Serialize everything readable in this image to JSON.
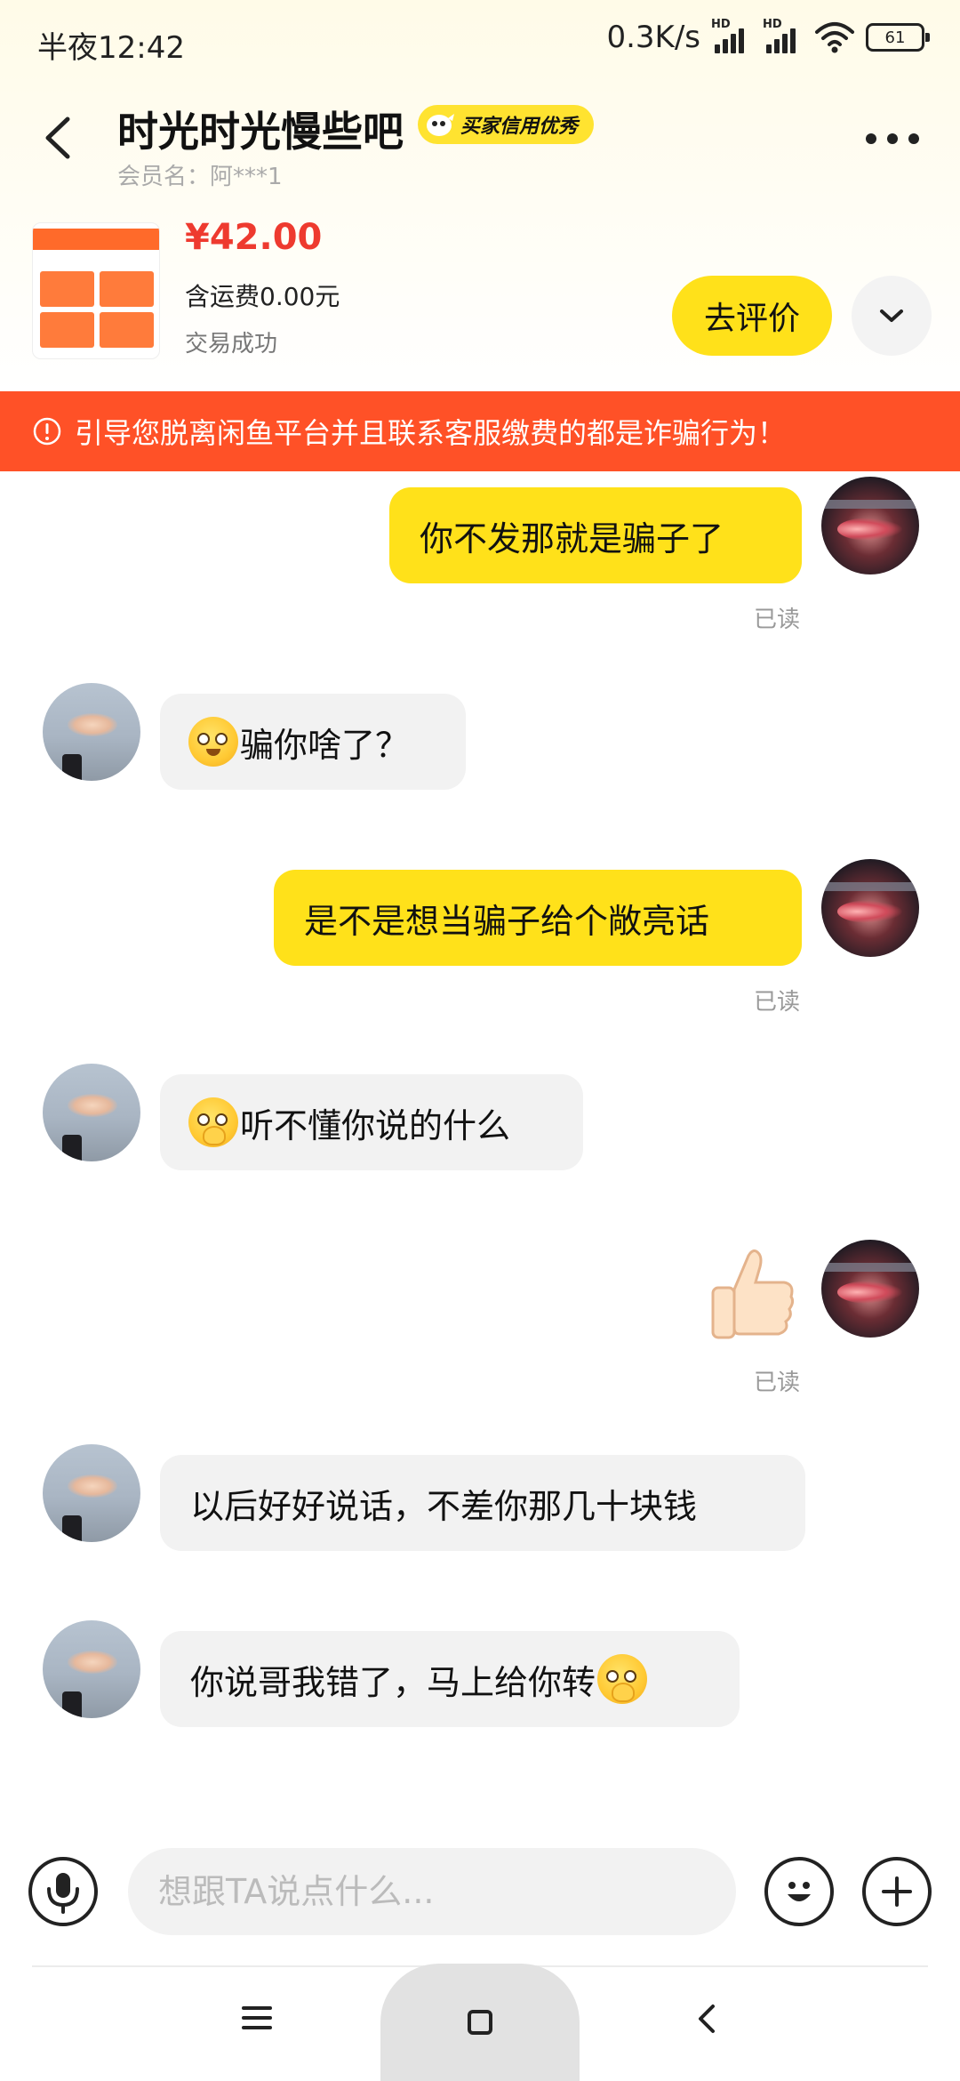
{
  "status_bar": {
    "time": "半夜12:42",
    "net_speed": "0.3K/s",
    "signal_tag": "HD",
    "battery": "61"
  },
  "header": {
    "title": "时光时光慢些吧",
    "credit_badge": "买家信用优秀",
    "member_label": "会员名：阿***1"
  },
  "product": {
    "price": "¥42.00",
    "shipping": "含运费0.00元",
    "status": "交易成功",
    "review_button": "去评价"
  },
  "warning": "引导您脱离闲鱼平台并且联系客服缴费的都是诈骗行为！",
  "messages": [
    {
      "side": "me",
      "text": "你不发那就是骗子了",
      "read": "已读"
    },
    {
      "side": "other",
      "text": "骗你啥了？",
      "emoji": "pleading-face"
    },
    {
      "side": "me",
      "text": "是不是想当骗子给个敞亮话",
      "read": "已读"
    },
    {
      "side": "other",
      "text": "听不懂你说的什么",
      "emoji": "face-holding-back-tears"
    },
    {
      "side": "me",
      "emoji": "thumbs-up",
      "read": "已读"
    },
    {
      "side": "other",
      "text": "以后好好说话，不差你那几十块钱"
    },
    {
      "side": "other",
      "text": "你说哥我错了，马上给你转",
      "emoji": "face-holding-back-tears"
    }
  ],
  "input": {
    "placeholder": "想跟TA说点什么..."
  },
  "icons": [
    "back-arrow-icon",
    "more-icon",
    "chevron-down-icon",
    "warning-icon",
    "microphone-icon",
    "emoji-icon",
    "plus-icon",
    "thumbs-up-icon"
  ],
  "colors": {
    "accent_yellow": "#ffe11a",
    "warning_orange": "#ff5127",
    "price_red": "#ee3a2f",
    "bubble_gray": "#f2f2f2"
  }
}
